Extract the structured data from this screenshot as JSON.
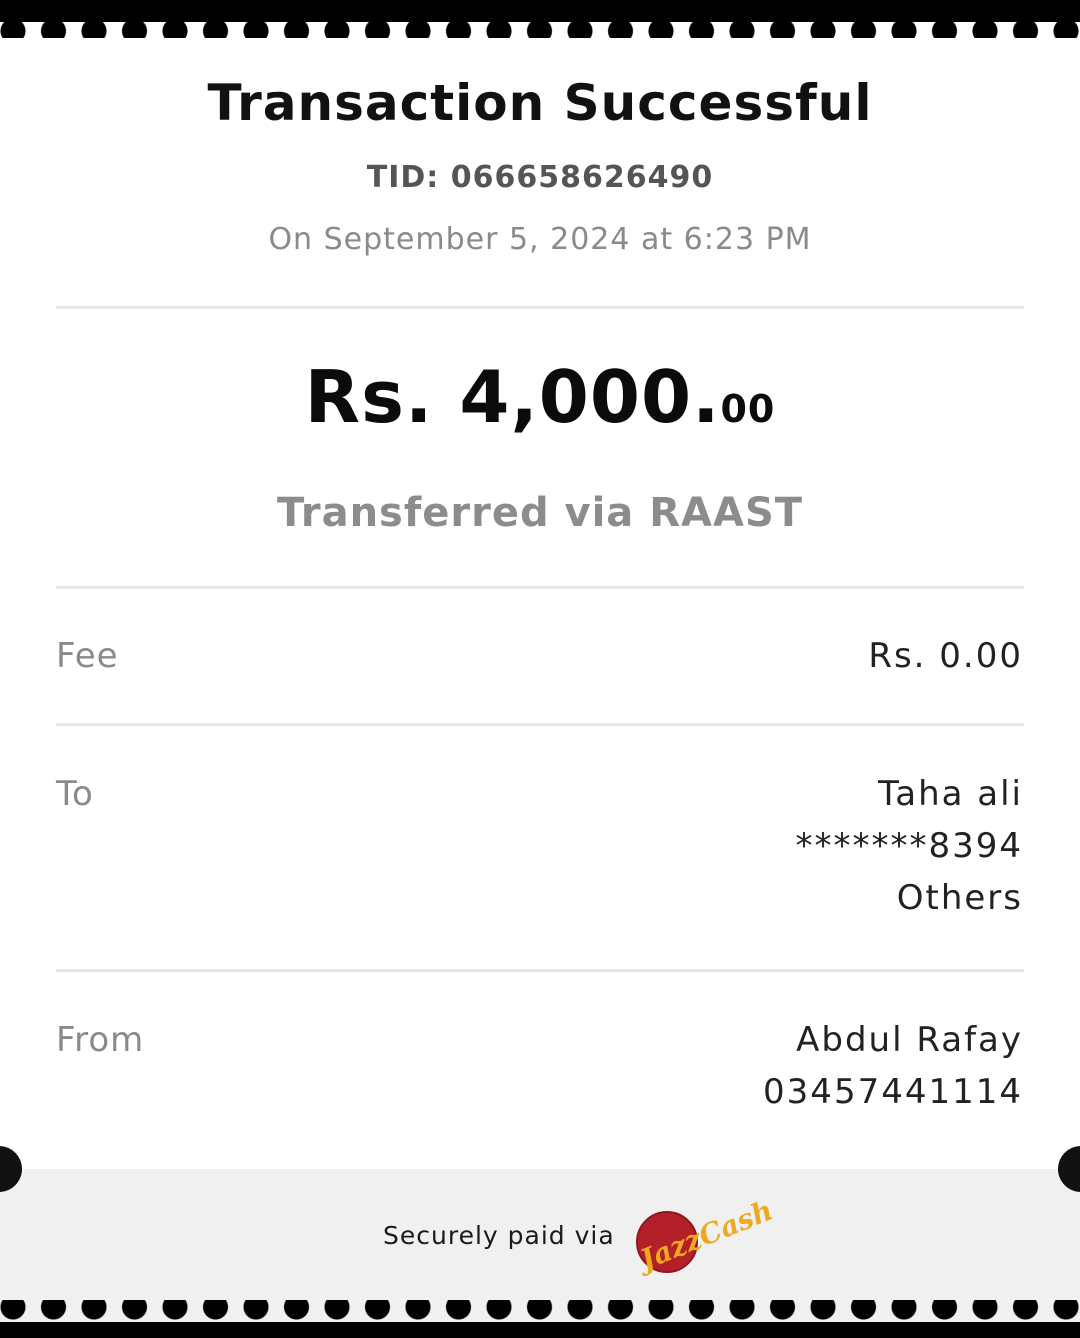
{
  "receipt": {
    "title": "Transaction Successful",
    "tid": "TID: 066658626490",
    "date": "On September 5, 2024 at 6:23 PM",
    "amount_main": "Rs. 4,000.",
    "amount_cents": "00",
    "method": "Transferred via RAAST"
  },
  "fee": {
    "label": "Fee",
    "value": "Rs. 0.00"
  },
  "to": {
    "label": "To",
    "name": "Taha ali",
    "account": "*******8394",
    "bank": "Others"
  },
  "from": {
    "label": "From",
    "name": "Abdul Rafay",
    "phone": "03457441114"
  },
  "footer": {
    "text": "Securely paid via",
    "logo_text": "JazzCash",
    "logo_colors": {
      "red": "#b3202a",
      "gold": "#f0a81c"
    }
  }
}
